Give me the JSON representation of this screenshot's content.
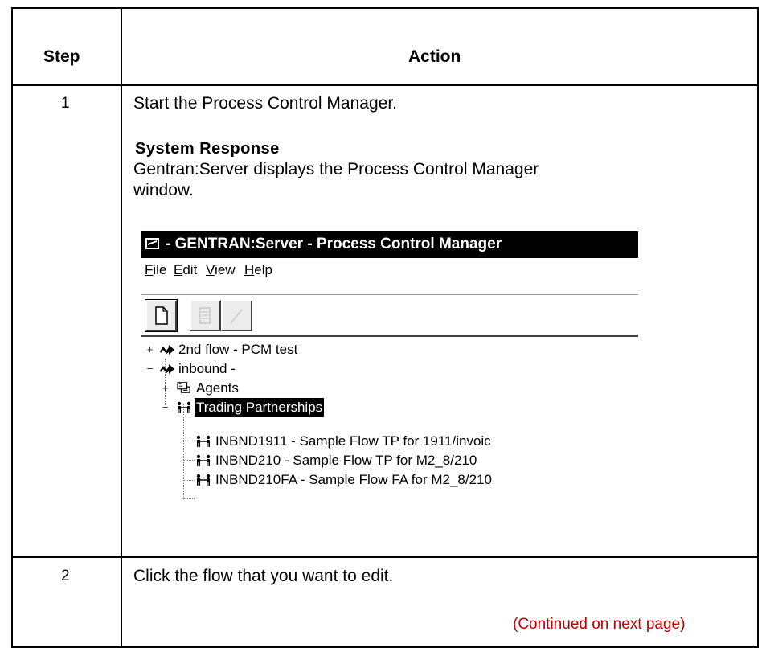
{
  "table": {
    "headers": {
      "step": "Step",
      "action": "Action"
    },
    "rows": [
      {
        "step": "1",
        "action": "Start the Process Control Manager.",
        "system_response_title": "System Response",
        "system_response_line1": "Gentran:Server displays the Process Control Manager",
        "system_response_line2": "window."
      },
      {
        "step": "2",
        "action": "Click the flow that you want to edit."
      }
    ],
    "continued": "(Continued on next page)"
  },
  "screenshot": {
    "title": "- GENTRAN:Server - Process Control Manager",
    "menu": [
      {
        "underline": "F",
        "rest": "ile"
      },
      {
        "underline": "E",
        "rest": "dit"
      },
      {
        "underline": "V",
        "rest": "iew"
      },
      {
        "underline": "H",
        "rest": "elp"
      }
    ],
    "toolbar": [
      "new-document-icon",
      "properties-icon",
      "edit-icon"
    ],
    "tree": [
      {
        "expander": "+",
        "icon": "flow-icon",
        "label": "2nd flow  -  PCM test"
      },
      {
        "expander": "−",
        "icon": "flow-icon",
        "label": "inbound  -"
      },
      {
        "expander": "+",
        "icon": "agents-icon",
        "label": "Agents"
      },
      {
        "expander": "−",
        "icon": "partners-icon",
        "label": "Trading Partnerships",
        "selected": true
      },
      {
        "icon": "partner-icon",
        "label": "INBND1911  -  Sample Flow TP for 1911/invoic"
      },
      {
        "icon": "partner-icon",
        "label": "INBND210  -  Sample Flow TP for M2_8/210"
      },
      {
        "icon": "partner-icon",
        "label": "INBND210FA  -  Sample Flow FA for M2_8/210"
      }
    ]
  }
}
